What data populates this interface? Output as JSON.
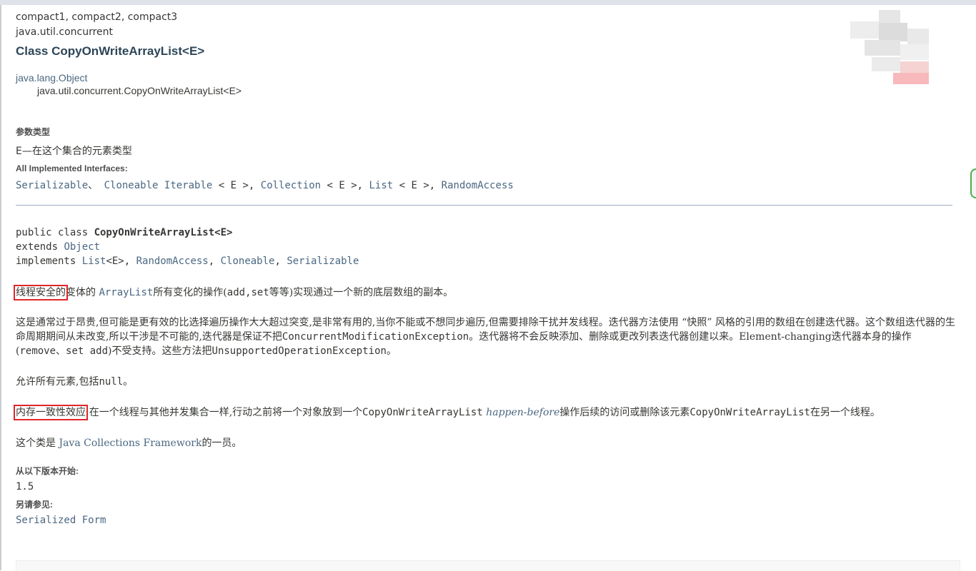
{
  "header": {
    "profiles": "compact1, compact2, compact3",
    "package": "java.util.concurrent",
    "title": "Class CopyOnWriteArrayList<E>"
  },
  "inheritance": {
    "parent": "java.lang.Object",
    "child": "java.util.concurrent.CopyOnWriteArrayList<E>"
  },
  "type_params": {
    "label": "参数类型",
    "value": "E—在这个集合的元素类型"
  },
  "interfaces": {
    "label": "All Implemented Interfaces:",
    "serializable": "Serializable",
    "sep1": "、 ",
    "cloneable": "Cloneable",
    "iterable": "Iterable",
    "generic1": " < E >, ",
    "collection": "Collection",
    "generic2": " < E >, ",
    "list": "List",
    "generic3": " < E >, ",
    "randomaccess": "RandomAccess"
  },
  "signature": {
    "line1_prefix": "public class ",
    "line1_name": "CopyOnWriteArrayList<E>",
    "line2_prefix": "extends ",
    "line2_link": "Object",
    "line3_prefix": "implements ",
    "list": "List",
    "list_generic": "<E>, ",
    "randomaccess": "RandomAccess",
    "sep": ", ",
    "cloneable": "Cloneable",
    "serializable": "Serializable"
  },
  "description": {
    "p1_highlight": "线程安全的",
    "p1_a": "变体的 ",
    "p1_link": "ArrayList",
    "p1_b": "所有变化的操作(",
    "p1_code": "add,set",
    "p1_c": "等等)实现通过一个新的底层数组的副本。",
    "p2_a": "这是通常过于昂贵,但可能是更有效的比选择遍历操作大大超过突变,是非常有用的,当你不能或不想同步遍历,但需要排除干扰并发线程。迭代器方法使用 “快照” 风格的引用的数组在创建迭代器。这个数组迭代器的生命周期期间从未改变,所以干涉是不可能的,迭代器是保证不把",
    "p2_code1": "ConcurrentModificationException",
    "p2_b": "。迭代器将不会反映添加、删除或更改列表迭代器创建以来。Element-changing迭代器本身的操作(",
    "p2_code2": "remove、set add",
    "p2_c": ")不受支持。这些方法把",
    "p2_code3": "UnsupportedOperationException",
    "p2_d": "。",
    "p3_a": "允许所有元素,包括",
    "p3_code": "null",
    "p3_b": "。",
    "p4_highlight": "内存一致性效应",
    "p4_a": ":在一个线程与其他并发集合一样,行动之前将一个对象放到一个",
    "p4_code1": "CopyOnWriteArrayList",
    "p4_italic": " happen-before",
    "p4_b": "操作后续的访问或删除该元素",
    "p4_code2": "CopyOnWriteArrayList",
    "p4_c": "在另一个线程。",
    "p5_a": "这个类是 ",
    "p5_link": "Java Collections Framework",
    "p5_b": "的一员。"
  },
  "since": {
    "label": "从以下版本开始:",
    "value": "1.5"
  },
  "see_also": {
    "label": "另请参见:",
    "link": "Serialized Form"
  },
  "colors": {
    "link": "#4a6782",
    "title": "#2c4557",
    "highlight_box": "#e0262a",
    "rule": "#9eadc0"
  }
}
